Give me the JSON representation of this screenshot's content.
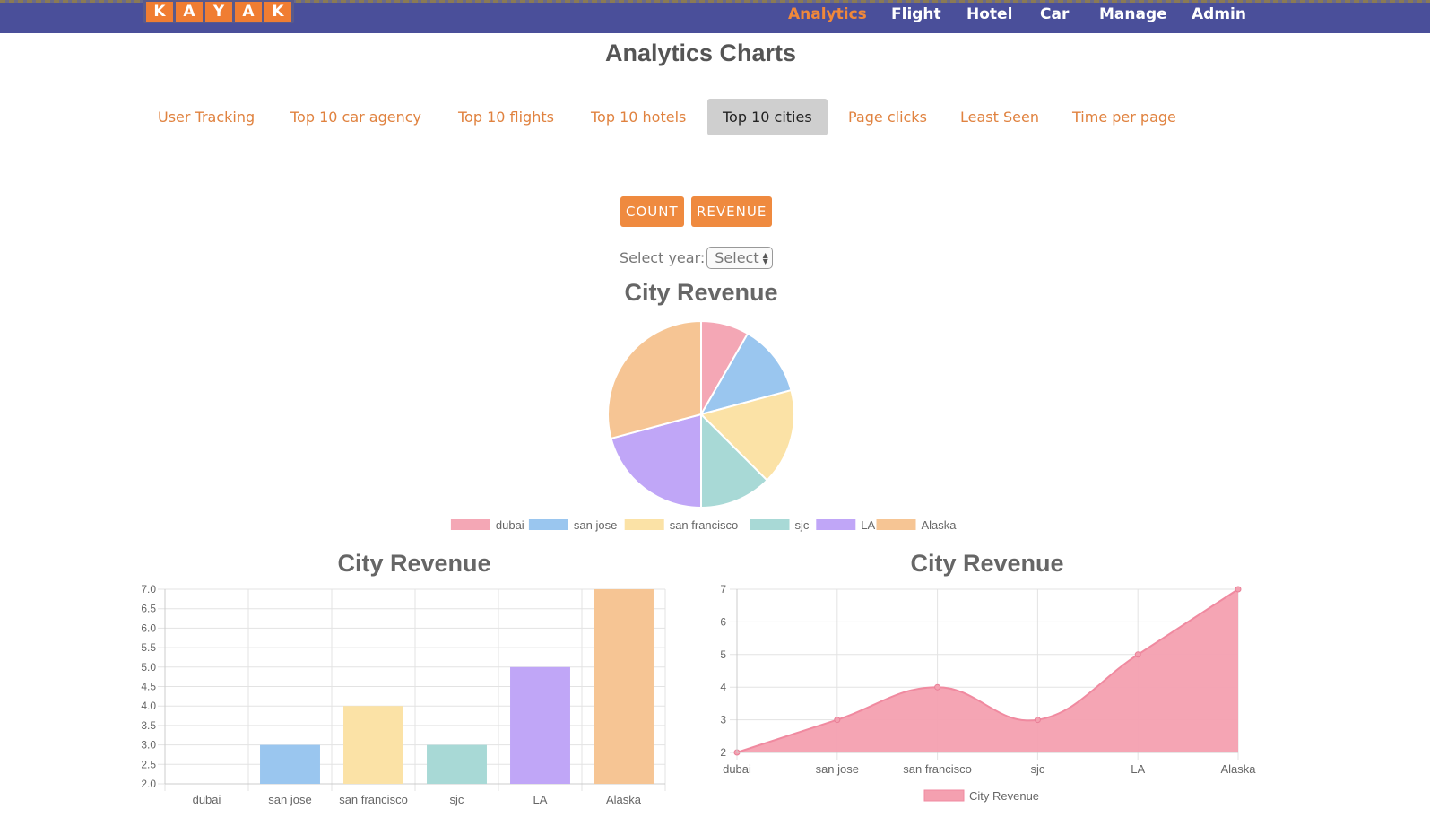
{
  "header": {
    "logo_letters": [
      "K",
      "A",
      "Y",
      "A",
      "K"
    ],
    "nav": [
      {
        "label": "Analytics",
        "active": true
      },
      {
        "label": "Flight",
        "active": false
      },
      {
        "label": "Hotel",
        "active": false
      },
      {
        "label": "Car",
        "active": false
      },
      {
        "label": "Manage",
        "active": false
      },
      {
        "label": "Admin",
        "active": false
      }
    ],
    "bar_color": "#4a4f9a",
    "accent_color": "#f0883a"
  },
  "page_title": "Analytics Charts",
  "tabs": [
    {
      "label": "User Tracking",
      "active": false
    },
    {
      "label": "Top 10 car agency",
      "active": false
    },
    {
      "label": "Top 10 flights",
      "active": false
    },
    {
      "label": "Top 10 hotels",
      "active": false
    },
    {
      "label": "Top 10 cities",
      "active": true
    },
    {
      "label": "Page clicks",
      "active": false
    },
    {
      "label": "Least Seen",
      "active": false
    },
    {
      "label": "Time per page",
      "active": false
    }
  ],
  "buttons": {
    "count": "COUNT",
    "revenue": "REVENUE"
  },
  "year_select": {
    "label": "Select year:",
    "value": "Select"
  },
  "chart_data": [
    {
      "type": "pie",
      "title": "City Revenue",
      "categories": [
        "dubai",
        "san jose",
        "san francisco",
        "sjc",
        "LA",
        "Alaska"
      ],
      "values": [
        2,
        3,
        4,
        3,
        5,
        7
      ],
      "colors": [
        "#f4a7b5",
        "#9ac6ef",
        "#fbe2a6",
        "#a8d9d6",
        "#c0a6f7",
        "#f6c594"
      ],
      "legend": "bottom"
    },
    {
      "type": "bar",
      "title": "City Revenue",
      "categories": [
        "dubai",
        "san jose",
        "san francisco",
        "sjc",
        "LA",
        "Alaska"
      ],
      "values": [
        2,
        3,
        4,
        3,
        5,
        7
      ],
      "colors": [
        "#f4a7b5",
        "#9ac6ef",
        "#fbe2a6",
        "#a8d9d6",
        "#c0a6f7",
        "#f6c594"
      ],
      "ylim": [
        2,
        7
      ],
      "yticks": [
        "2.0",
        "2.5",
        "3.0",
        "3.5",
        "4.0",
        "4.5",
        "5.0",
        "5.5",
        "6.0",
        "6.5",
        "7.0"
      ],
      "grid": true
    },
    {
      "type": "area",
      "title": "City Revenue",
      "categories": [
        "dubai",
        "san jose",
        "san francisco",
        "sjc",
        "LA",
        "Alaska"
      ],
      "series": [
        {
          "name": "City Revenue",
          "values": [
            2,
            3,
            4,
            3,
            5,
            7
          ],
          "color": "#f4a0b0"
        }
      ],
      "ylim": [
        2,
        7
      ],
      "yticks": [
        "2",
        "3",
        "4",
        "5",
        "6",
        "7"
      ],
      "grid": true,
      "legend": "bottom"
    }
  ]
}
